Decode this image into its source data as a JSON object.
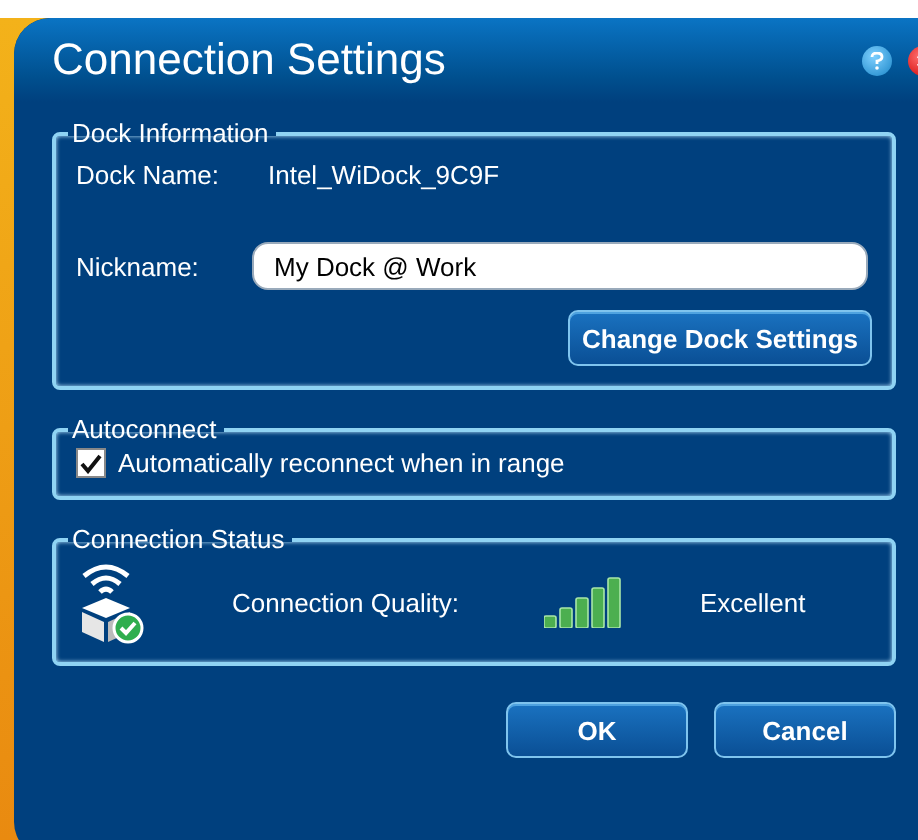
{
  "window": {
    "title": "Connection Settings"
  },
  "dock_information": {
    "legend": "Dock Information",
    "dock_name_label": "Dock Name:",
    "dock_name": "Intel_WiDock_9C9F",
    "nickname_label": "Nickname:",
    "nickname": "My Dock @ Work",
    "change_button": "Change Dock Settings"
  },
  "autoconnect": {
    "legend": "Autoconnect",
    "option": {
      "label": "Automatically reconnect when in range",
      "checked": true
    }
  },
  "connection_status": {
    "legend": "Connection Status",
    "quality_label": "Connection Quality:",
    "quality": "Excellent"
  },
  "buttons": [
    {
      "label": "OK"
    },
    {
      "label": "Cancel"
    }
  ]
}
